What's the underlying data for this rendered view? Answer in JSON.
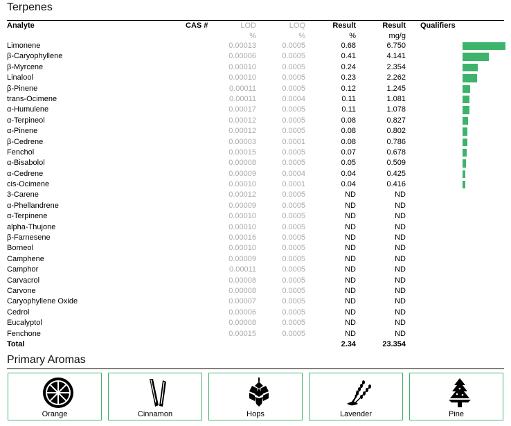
{
  "section_title": "Terpenes",
  "headers": {
    "analyte": "Analyte",
    "cas": "CAS #",
    "lod": "LOD",
    "loq": "LOQ",
    "result_pct": "Result",
    "result_mg": "Result",
    "qualifiers": "Qualifiers"
  },
  "units": {
    "lod": "%",
    "loq": "%",
    "result_pct": "%",
    "result_mg": "mg/g"
  },
  "max_mg": 6.75,
  "rows": [
    {
      "name": "Limonene",
      "lod": "0.00013",
      "loq": "0.0005",
      "pct": "0.68",
      "mg": "6.750",
      "mg_value": 6.75
    },
    {
      "name": "β-Caryophyllene",
      "lod": "0.00006",
      "loq": "0.0005",
      "pct": "0.41",
      "mg": "4.141",
      "mg_value": 4.141
    },
    {
      "name": "β-Myrcene",
      "lod": "0.00010",
      "loq": "0.0005",
      "pct": "0.24",
      "mg": "2.354",
      "mg_value": 2.354
    },
    {
      "name": "Linalool",
      "lod": "0.00010",
      "loq": "0.0005",
      "pct": "0.23",
      "mg": "2.262",
      "mg_value": 2.262
    },
    {
      "name": "β-Pinene",
      "lod": "0.00011",
      "loq": "0.0005",
      "pct": "0.12",
      "mg": "1.245",
      "mg_value": 1.245
    },
    {
      "name": "trans-Ocimene",
      "lod": "0.00011",
      "loq": "0.0004",
      "pct": "0.11",
      "mg": "1.081",
      "mg_value": 1.081
    },
    {
      "name": "α-Humulene",
      "lod": "0.00017",
      "loq": "0.0005",
      "pct": "0.11",
      "mg": "1.078",
      "mg_value": 1.078
    },
    {
      "name": "α-Terpineol",
      "lod": "0.00012",
      "loq": "0.0005",
      "pct": "0.08",
      "mg": "0.827",
      "mg_value": 0.827
    },
    {
      "name": "α-Pinene",
      "lod": "0.00012",
      "loq": "0.0005",
      "pct": "0.08",
      "mg": "0.802",
      "mg_value": 0.802
    },
    {
      "name": "β-Cedrene",
      "lod": "0.00003",
      "loq": "0.0001",
      "pct": "0.08",
      "mg": "0.786",
      "mg_value": 0.786
    },
    {
      "name": "Fenchol",
      "lod": "0.00015",
      "loq": "0.0005",
      "pct": "0.07",
      "mg": "0.678",
      "mg_value": 0.678
    },
    {
      "name": "α-Bisabolol",
      "lod": "0.00008",
      "loq": "0.0005",
      "pct": "0.05",
      "mg": "0.509",
      "mg_value": 0.509
    },
    {
      "name": "α-Cedrene",
      "lod": "0.00009",
      "loq": "0.0004",
      "pct": "0.04",
      "mg": "0.425",
      "mg_value": 0.425
    },
    {
      "name": "cis-Ocimene",
      "lod": "0.00010",
      "loq": "0.0001",
      "pct": "0.04",
      "mg": "0.416",
      "mg_value": 0.416
    },
    {
      "name": "3-Carene",
      "lod": "0.00012",
      "loq": "0.0005",
      "pct": "ND",
      "mg": "ND",
      "mg_value": 0
    },
    {
      "name": "α-Phellandrene",
      "lod": "0.00009",
      "loq": "0.0005",
      "pct": "ND",
      "mg": "ND",
      "mg_value": 0
    },
    {
      "name": "α-Terpinene",
      "lod": "0.00010",
      "loq": "0.0005",
      "pct": "ND",
      "mg": "ND",
      "mg_value": 0
    },
    {
      "name": "alpha-Thujone",
      "lod": "0.00010",
      "loq": "0.0005",
      "pct": "ND",
      "mg": "ND",
      "mg_value": 0
    },
    {
      "name": "β-Farnesene",
      "lod": "0.00016",
      "loq": "0.0005",
      "pct": "ND",
      "mg": "ND",
      "mg_value": 0
    },
    {
      "name": "Borneol",
      "lod": "0.00010",
      "loq": "0.0005",
      "pct": "ND",
      "mg": "ND",
      "mg_value": 0
    },
    {
      "name": "Camphene",
      "lod": "0.00009",
      "loq": "0.0005",
      "pct": "ND",
      "mg": "ND",
      "mg_value": 0
    },
    {
      "name": "Camphor",
      "lod": "0.00011",
      "loq": "0.0005",
      "pct": "ND",
      "mg": "ND",
      "mg_value": 0
    },
    {
      "name": "Carvacrol",
      "lod": "0.00008",
      "loq": "0.0005",
      "pct": "ND",
      "mg": "ND",
      "mg_value": 0
    },
    {
      "name": "Carvone",
      "lod": "0.00008",
      "loq": "0.0005",
      "pct": "ND",
      "mg": "ND",
      "mg_value": 0
    },
    {
      "name": "Caryophyllene Oxide",
      "lod": "0.00007",
      "loq": "0.0005",
      "pct": "ND",
      "mg": "ND",
      "mg_value": 0
    },
    {
      "name": "Cedrol",
      "lod": "0.00006",
      "loq": "0.0005",
      "pct": "ND",
      "mg": "ND",
      "mg_value": 0
    },
    {
      "name": "Eucalyptol",
      "lod": "0.00008",
      "loq": "0.0005",
      "pct": "ND",
      "mg": "ND",
      "mg_value": 0
    },
    {
      "name": "Fenchone",
      "lod": "0.00015",
      "loq": "0.0005",
      "pct": "ND",
      "mg": "ND",
      "mg_value": 0
    }
  ],
  "total": {
    "label": "Total",
    "pct": "2.34",
    "mg": "23.354"
  },
  "aromas_title": "Primary Aromas",
  "aromas": [
    {
      "label": "Orange",
      "icon": "orange-icon"
    },
    {
      "label": "Cinnamon",
      "icon": "cinnamon-icon"
    },
    {
      "label": "Hops",
      "icon": "hops-icon"
    },
    {
      "label": "Lavender",
      "icon": "lavender-icon"
    },
    {
      "label": "Pine",
      "icon": "pine-icon"
    }
  ],
  "colors": {
    "bar": "#3db36b",
    "border": "#3db36b",
    "muted": "#aaaaaa"
  }
}
